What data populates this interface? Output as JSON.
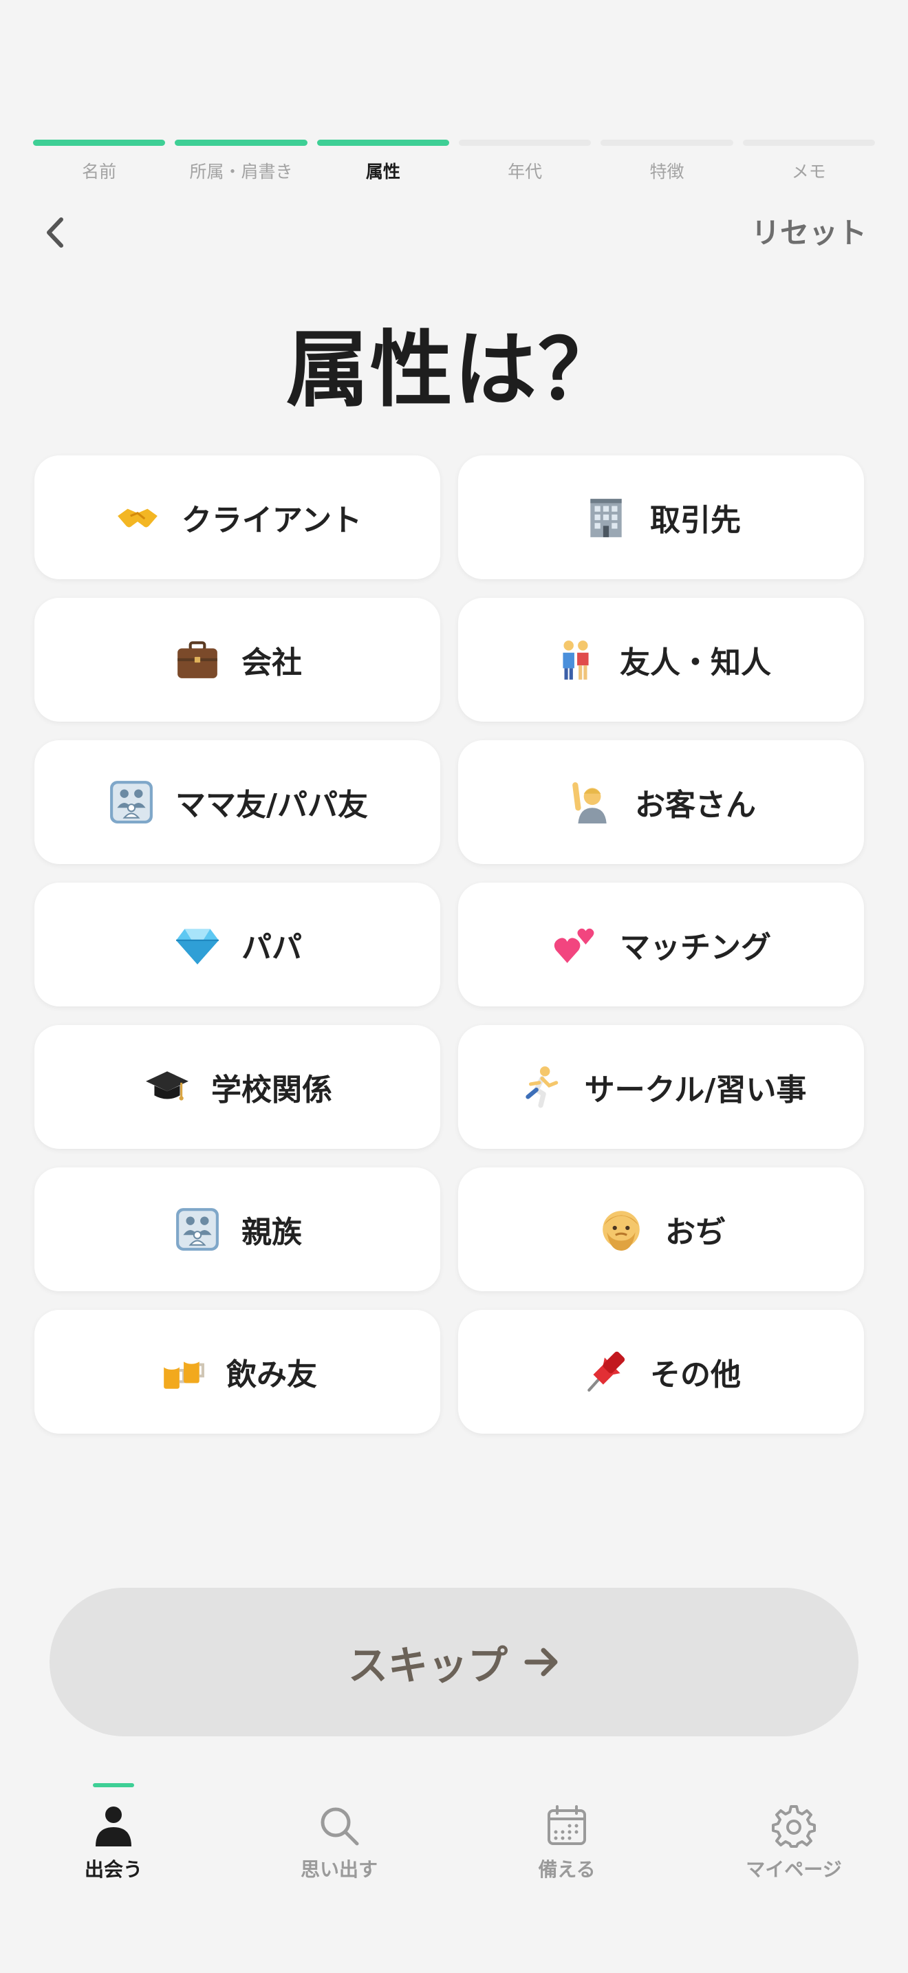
{
  "progress": {
    "steps": [
      {
        "label": "名前",
        "state": "done"
      },
      {
        "label": "所属・肩書き",
        "state": "done"
      },
      {
        "label": "属性",
        "state": "current"
      },
      {
        "label": "年代",
        "state": "todo"
      },
      {
        "label": "特徴",
        "state": "todo"
      },
      {
        "label": "メモ",
        "state": "todo"
      }
    ],
    "accent_color": "#3ecf95"
  },
  "nav": {
    "back_icon": "chevron-left-icon",
    "reset_label": "リセット"
  },
  "title": "属性は？",
  "options": [
    {
      "label": "クライアント",
      "icon": "handshake-icon"
    },
    {
      "label": "取引先",
      "icon": "office-building-icon"
    },
    {
      "label": "会社",
      "icon": "briefcase-icon"
    },
    {
      "label": "友人・知人",
      "icon": "couple-icon"
    },
    {
      "label": "ママ友/パパ友",
      "icon": "family-icon"
    },
    {
      "label": "お客さん",
      "icon": "person-raising-hand-icon"
    },
    {
      "label": "パパ",
      "icon": "gem-icon"
    },
    {
      "label": "マッチング",
      "icon": "two-hearts-icon"
    },
    {
      "label": "学校関係",
      "icon": "graduation-cap-icon"
    },
    {
      "label": "サークル/習い事",
      "icon": "runner-icon"
    },
    {
      "label": "親族",
      "icon": "family-icon"
    },
    {
      "label": "おぢ",
      "icon": "older-man-icon"
    },
    {
      "label": "飲み友",
      "icon": "beer-mugs-icon"
    },
    {
      "label": "その他",
      "icon": "pushpin-icon"
    }
  ],
  "skip": {
    "label": "スキップ",
    "icon": "arrow-right-icon"
  },
  "tabbar": {
    "tabs": [
      {
        "label": "出会う",
        "icon": "person-icon",
        "active": true
      },
      {
        "label": "思い出す",
        "icon": "search-icon",
        "active": false
      },
      {
        "label": "備える",
        "icon": "calendar-icon",
        "active": false
      },
      {
        "label": "マイページ",
        "icon": "gear-icon",
        "active": false
      }
    ]
  }
}
